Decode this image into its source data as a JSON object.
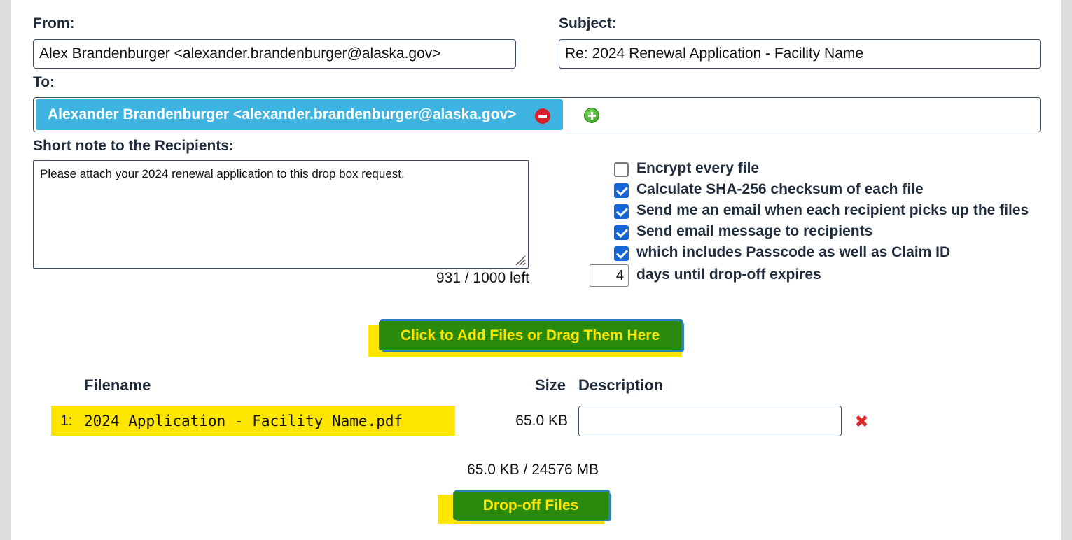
{
  "form": {
    "from_label": "From:",
    "from_value": "Alex Brandenburger  <alexander.brandenburger@alaska.gov>",
    "subject_label": "Subject:",
    "subject_value": "Re: 2024 Renewal Application - Facility Name",
    "to_label": "To:",
    "recipients": [
      {
        "display": "Alexander Brandenburger <alexander.brandenburger@alaska.gov>"
      }
    ],
    "note_label": "Short note to the Recipients:",
    "note_value": "Please attach your 2024 renewal application to this drop box request.",
    "char_count": "931 / 1000 left"
  },
  "options": {
    "items": [
      {
        "label": "Encrypt every file",
        "checked": false
      },
      {
        "label": "Calculate SHA-256 checksum of each file",
        "checked": true
      },
      {
        "label": "Send me an email when each recipient picks up the files",
        "checked": true
      },
      {
        "label": "Send email message to recipients",
        "checked": true
      },
      {
        "label": "which includes Passcode as well as Claim ID",
        "checked": true
      }
    ],
    "expire_days": "4",
    "expire_label": "days until drop-off expires"
  },
  "add_files_button": "Click to Add Files or Drag Them Here",
  "files_table": {
    "headers": {
      "filename": "Filename",
      "size": "Size",
      "description": "Description"
    },
    "rows": [
      {
        "index": "1:",
        "name": "2024 Application - Facility Name.pdf",
        "size": "65.0 KB",
        "description": ""
      }
    ]
  },
  "total_size": "65.0 KB / 24576 MB",
  "dropoff_button": "Drop-off Files",
  "colors": {
    "highlight": "#ffe600",
    "button_green": "#2a8a0c",
    "pill_blue": "#3fb3e0"
  },
  "icons": [
    "remove-recipient-icon",
    "add-recipient-icon",
    "delete-file-icon"
  ]
}
